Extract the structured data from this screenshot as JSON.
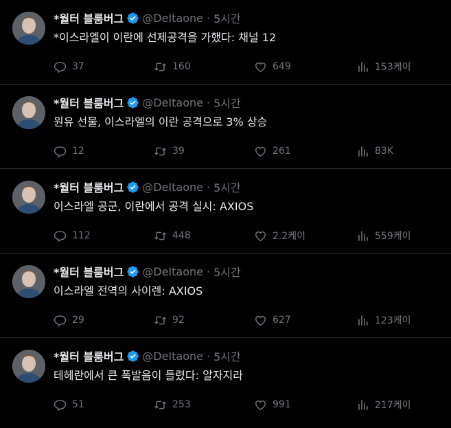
{
  "tweets": [
    {
      "name": "*월터 블룸버그",
      "handle": "@DeItaone",
      "separator": "·",
      "time": "5시간",
      "text": "*이스라엘이 이란에 선제공격을 가했다: 채널 12",
      "replies": "37",
      "retweets": "160",
      "likes": "649",
      "views": "153케이"
    },
    {
      "name": "*월터 블룸버그",
      "handle": "@DeItaone",
      "separator": "·",
      "time": "5시간",
      "text": "원유 선물, 이스라엘의 이란 공격으로 3% 상승",
      "replies": "12",
      "retweets": "39",
      "likes": "261",
      "views": "83K"
    },
    {
      "name": "*월터 블룸버그",
      "handle": "@DeItaone",
      "separator": "·",
      "time": "5시간",
      "text": "이스라엘 공군, 이란에서 공격 실시: AXIOS",
      "replies": "112",
      "retweets": "448",
      "likes": "2.2케이",
      "views": "559케이"
    },
    {
      "name": "*월터 블룸버그",
      "handle": "@DeItaone",
      "separator": "·",
      "time": "5시간",
      "text": "이스라엘 전역의 사이렌: AXIOS",
      "replies": "29",
      "retweets": "92",
      "likes": "627",
      "views": "123케이"
    },
    {
      "name": "*월터 블룸버그",
      "handle": "@DeItaone",
      "separator": "·",
      "time": "5시간",
      "text": "테헤란에서 큰 폭발음이 들렸다: 알자지라",
      "replies": "51",
      "retweets": "253",
      "likes": "991",
      "views": "217케이"
    }
  ],
  "colors": {
    "background": "#000000",
    "text": "#e7e9ea",
    "muted": "#71767b",
    "verified": "#1d9bf0",
    "divider": "#2f3336"
  },
  "icons": {
    "avatar": "avatar",
    "verified": "verified-badge-icon",
    "reply": "reply-icon",
    "retweet": "retweet-icon",
    "like": "heart-icon",
    "views": "views-chart-icon"
  }
}
